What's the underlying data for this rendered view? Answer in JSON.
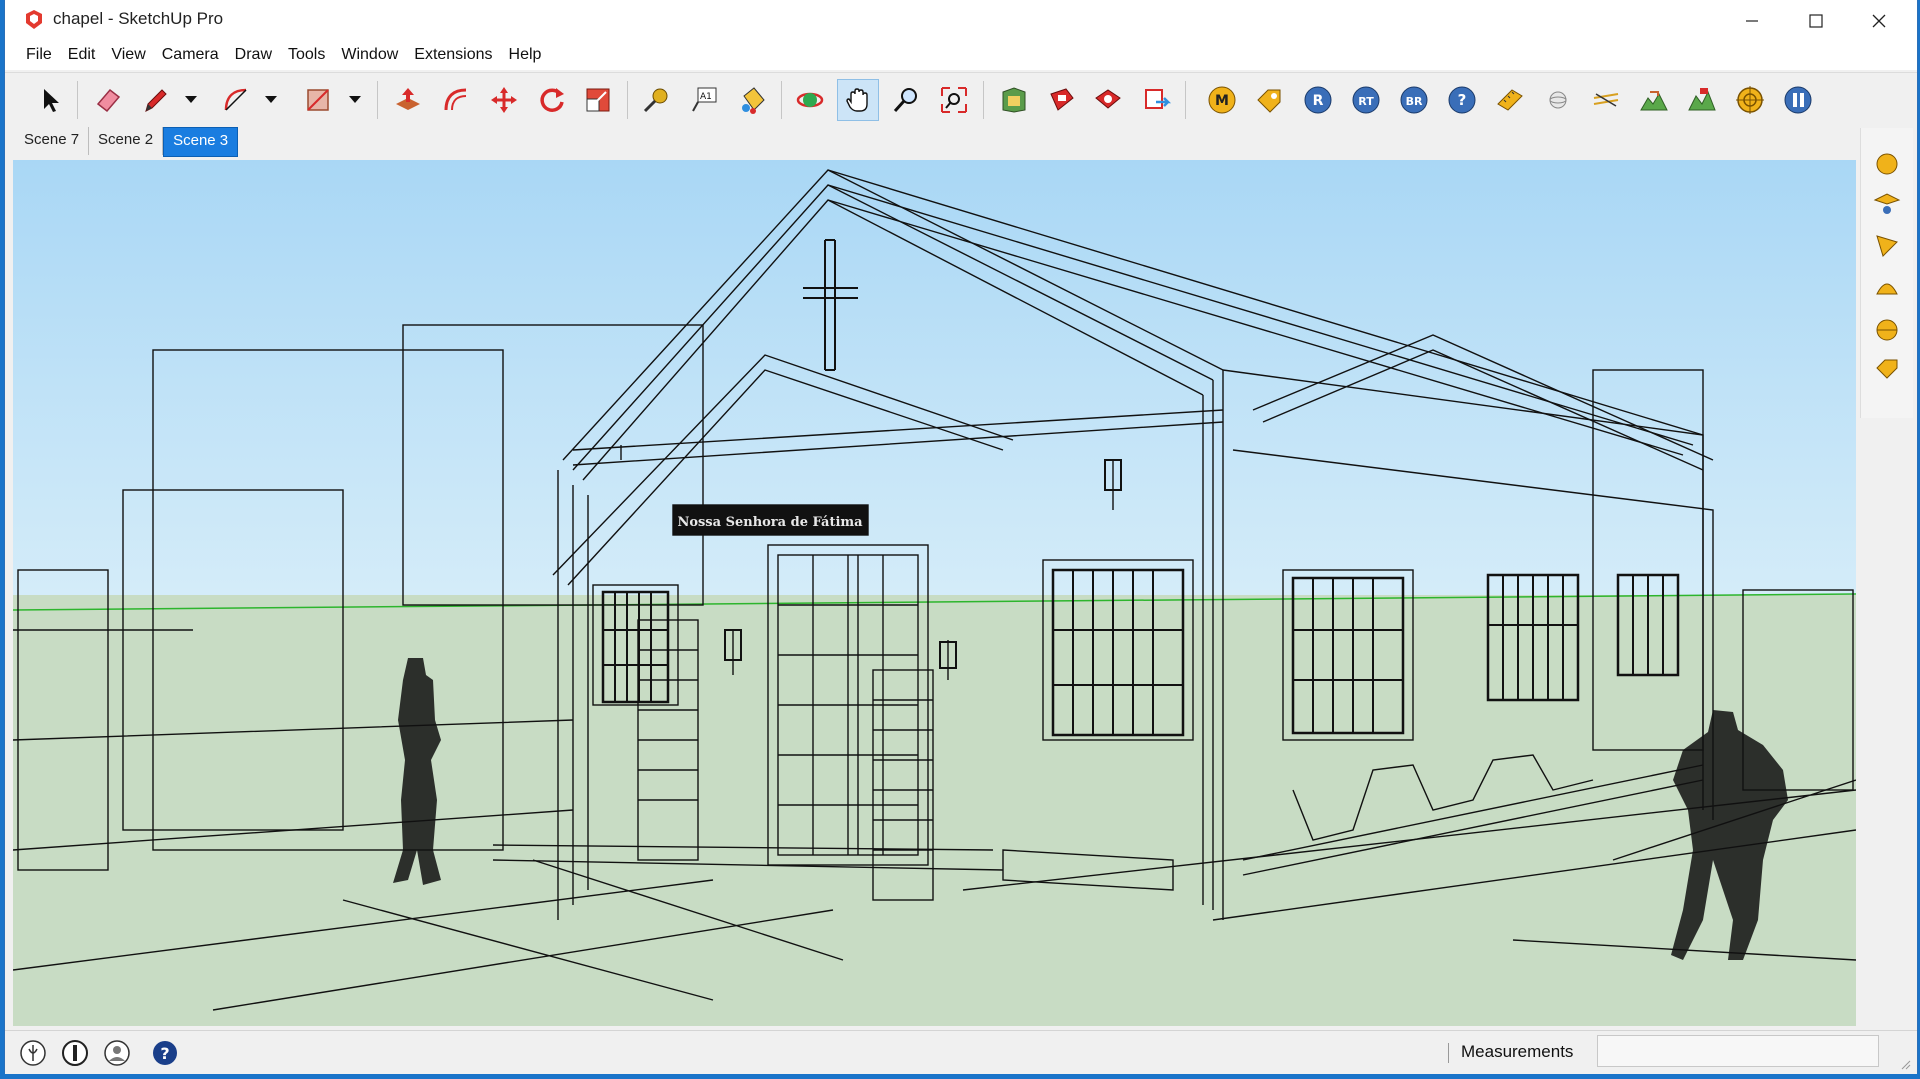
{
  "window": {
    "title": "chapel - SketchUp Pro"
  },
  "menu": [
    "File",
    "Edit",
    "View",
    "Camera",
    "Draw",
    "Tools",
    "Window",
    "Extensions",
    "Help"
  ],
  "toolbar": {
    "tools": [
      "select-icon",
      "eraser-icon",
      "pencil-icon",
      "arc-icon",
      "rectangle-icon",
      "push-pull-icon",
      "offset-icon",
      "move-icon",
      "rotate-icon",
      "scale-icon",
      "tape-measure-icon",
      "text-icon",
      "paint-bucket-icon",
      "orbit-icon",
      "pan-icon",
      "zoom-icon",
      "zoom-extents-icon",
      "3d-warehouse-icon",
      "extension-warehouse-icon",
      "extension-manager-icon",
      "layout-icon",
      "m-icon",
      "tag-icon",
      "r-icon",
      "rt-icon",
      "br-icon",
      "help-icon",
      "ruler-icon",
      "sphere-icon",
      "section-icon",
      "terrain-icon",
      "terrain2-icon",
      "target-icon",
      "pause-icon"
    ],
    "round_labels": {
      "m": "M",
      "r": "R",
      "rt": "RT",
      "br": "BR",
      "q": "?"
    },
    "active_tool": "pan-icon"
  },
  "scenes": {
    "tabs": [
      "Scene 7",
      "Scene 2",
      "Scene 3"
    ],
    "active": "Scene 3"
  },
  "statusbar": {
    "measurements_label": "Measurements",
    "measurements_value": ""
  },
  "viewport": {
    "sign_text": "Nossa Senhora de Fátima"
  },
  "colors": {
    "sky_top": "#a9d7f5",
    "sky_bottom": "#d4ecf9",
    "ground": "#c8dcc4",
    "accent": "#1a7de0",
    "horizon": "#2db52d"
  }
}
